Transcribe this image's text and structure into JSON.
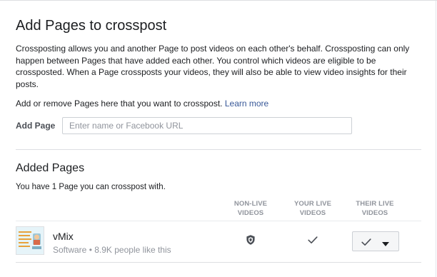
{
  "dialog": {
    "title": "Add Pages to crosspost",
    "description": "Crossposting allows you and another Page to post videos on each other's behalf. Crossposting can only happen between Pages that have added each other. You control which videos are eligible to be crossposted. When a Page crossposts your videos, they will also be able to view video insights for their posts.",
    "helper_text": "Add or remove Pages here that you want to crosspost.",
    "learn_more": "Learn more"
  },
  "add_page": {
    "label": "Add Page",
    "placeholder": "Enter name or Facebook URL",
    "value": ""
  },
  "added_pages": {
    "title": "Added Pages",
    "count_text": "You have 1 Page you can crosspost with.",
    "columns": {
      "non_live_line1": "NON-LIVE",
      "non_live_line2": "VIDEOS",
      "your_live_line1": "YOUR LIVE",
      "your_live_line2": "VIDEOS",
      "their_live_line1": "THEIR LIVE",
      "their_live_line2": "VIDEOS"
    },
    "rows": [
      {
        "name": "vMix",
        "subtitle": "Software • 8.9K people like this",
        "non_live_icon": "shield-icon",
        "your_live_icon": "check-icon",
        "their_live_icon": "check-icon"
      }
    ]
  },
  "colors": {
    "link": "#385898",
    "muted": "#90949c",
    "border": "#ccd0d5",
    "text": "#1c1e21"
  }
}
